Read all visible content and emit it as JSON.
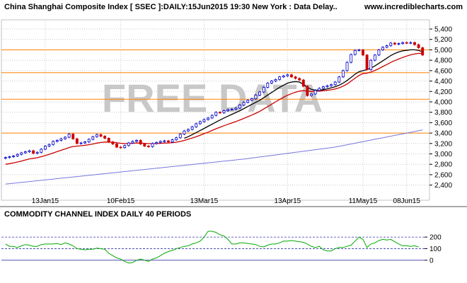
{
  "header": {
    "title": "China Shanghai Composite Index [ SSEC ]:DAILY:15Jun2015 19:30 New York : Data Delay..",
    "site": "www.incrediblecharts.com"
  },
  "watermark": "FREE DATA",
  "colors": {
    "bull": "#0000cc",
    "bear": "#cc0000",
    "ema_short": "#cc0000",
    "ema_mid": "#000000",
    "ma_long": "#7777dd",
    "resistance": "#ff8000",
    "cci": "#00aa00",
    "cci_zero": "#3333aa",
    "grid": "#c8c8c8"
  },
  "chart_data": [
    {
      "type": "candlestick",
      "ylim": [
        2150,
        5550
      ],
      "y_ticks": [
        "2,400",
        "2,600",
        "2,800",
        "3,000",
        "3,200",
        "3,400",
        "3,600",
        "3,800",
        "4,000",
        "4,200",
        "4,400",
        "4,600",
        "4,800",
        "5,000",
        "5,200",
        "5,400"
      ],
      "x_tick_labels": [
        "13Jan15",
        "10Feb15",
        "13Mar15",
        "13Apr15",
        "11May15",
        "08Jun15"
      ],
      "horizontal_lines": [
        3400,
        4050,
        4560,
        5000
      ],
      "closes": [
        2930,
        2945,
        2960,
        2990,
        3020,
        3040,
        3060,
        3010,
        3030,
        3090,
        3150,
        3180,
        3240,
        3260,
        3290,
        3320,
        3380,
        3290,
        3200,
        3210,
        3230,
        3280,
        3330,
        3370,
        3340,
        3300,
        3230,
        3190,
        3130,
        3120,
        3160,
        3210,
        3240,
        3260,
        3190,
        3150,
        3140,
        3200,
        3220,
        3240,
        3250,
        3230,
        3270,
        3310,
        3380,
        3440,
        3470,
        3520,
        3580,
        3620,
        3660,
        3690,
        3740,
        3800,
        3790,
        3830,
        3850,
        3860,
        3880,
        3940,
        3990,
        4030,
        4060,
        4130,
        4190,
        4280,
        4360,
        4400,
        4430,
        4480,
        4500,
        4520,
        4480,
        4450,
        4420,
        4300,
        4120,
        4150,
        4220,
        4260,
        4290,
        4310,
        4330,
        4380,
        4480,
        4600,
        4760,
        4910,
        4990,
        5000,
        4900,
        4620,
        4800,
        4900,
        5000,
        5050,
        5080,
        5130,
        5110,
        5120,
        5140,
        5130,
        5140,
        5100,
        5040,
        4900
      ],
      "series": [
        {
          "name": "",
          "kind": "ema_short",
          "values": [
            2800,
            2812,
            2826,
            2843,
            2862,
            2883,
            2904,
            2915,
            2927,
            2946,
            2968,
            2992,
            3018,
            3043,
            3069,
            3094,
            3123,
            3141,
            3149,
            3157,
            3165,
            3177,
            3191,
            3207,
            3219,
            3227,
            3228,
            3224,
            3214,
            3204,
            3199,
            3200,
            3204,
            3210,
            3208,
            3203,
            3197,
            3197,
            3199,
            3203,
            3208,
            3210,
            3216,
            3225,
            3240,
            3259,
            3281,
            3305,
            3331,
            3359,
            3389,
            3418,
            3450,
            3483,
            3511,
            3541,
            3569,
            3596,
            3622,
            3652,
            3682,
            3714,
            3745,
            3781,
            3819,
            3862,
            3908,
            3955,
            4000,
            4046,
            4088,
            4128,
            4159,
            4185,
            4206,
            4214,
            4205,
            4200,
            4202,
            4207,
            4214,
            4223,
            4232,
            4247,
            4270,
            4301,
            4343,
            4399,
            4455,
            4508,
            4544,
            4551,
            4574,
            4603,
            4639,
            4679,
            4718,
            4759,
            4793,
            4824,
            4854,
            4880,
            4904,
            4921,
            4932,
            4930
          ]
        },
        {
          "name": "",
          "kind": "ema_mid",
          "values": [
            null,
            null,
            null,
            null,
            null,
            null,
            null,
            null,
            null,
            null,
            null,
            null,
            null,
            null,
            null,
            null,
            null,
            null,
            null,
            null,
            null,
            null,
            null,
            null,
            null,
            null,
            null,
            null,
            null,
            null,
            null,
            null,
            null,
            null,
            null,
            null,
            null,
            null,
            null,
            null,
            null,
            null,
            null,
            null,
            null,
            3300,
            3330,
            3370,
            3410,
            3450,
            3490,
            3530,
            3570,
            3610,
            3650,
            3690,
            3725,
            3760,
            3795,
            3830,
            3870,
            3910,
            3950,
            3990,
            4030,
            4080,
            4130,
            4180,
            4230,
            4280,
            4320,
            4360,
            4380,
            4390,
            4380,
            4340,
            4280,
            4240,
            4225,
            4225,
            4235,
            4250,
            4270,
            4290,
            4320,
            4360,
            4410,
            4470,
            4530,
            4580,
            4600,
            4620,
            4650,
            4690,
            4740,
            4790,
            4840,
            4890,
            4930,
            4960,
            4980,
            4990,
            5000,
            5000,
            4990,
            4960
          ]
        },
        {
          "name": "",
          "kind": "ma_long",
          "values": [
            2420,
            2428,
            2436,
            2444,
            2452,
            2460,
            2468,
            2476,
            2484,
            2492,
            2500,
            2508,
            2516,
            2524,
            2532,
            2540,
            2548,
            2556,
            2564,
            2572,
            2580,
            2588,
            2596,
            2604,
            2612,
            2620,
            2628,
            2636,
            2644,
            2652,
            2660,
            2668,
            2676,
            2684,
            2692,
            2700,
            2708,
            2716,
            2724,
            2732,
            2740,
            2748,
            2756,
            2764,
            2772,
            2780,
            2788,
            2796,
            2804,
            2812,
            2820,
            2828,
            2836,
            2844,
            2852,
            2860,
            2868,
            2876,
            2884,
            2892,
            2900,
            2910,
            2920,
            2930,
            2940,
            2950,
            2960,
            2970,
            2980,
            2990,
            3000,
            3010,
            3020,
            3030,
            3040,
            3050,
            3060,
            3070,
            3080,
            3090,
            3100,
            3110,
            3120,
            3130,
            3145,
            3160,
            3175,
            3190,
            3205,
            3220,
            3235,
            3250,
            3265,
            3280,
            3295,
            3310,
            3325,
            3340,
            3355,
            3370,
            3385,
            3400,
            3415,
            3430,
            3445,
            3460
          ]
        }
      ]
    },
    {
      "type": "line",
      "title": "COMMODITY CHANNEL INDEX DAILY 40 PERIODS",
      "ylim": [
        -50,
        280
      ],
      "y_ticks": [
        "200",
        "100",
        "0"
      ],
      "reference_lines": [
        200,
        100,
        0
      ],
      "values": [
        140,
        120,
        120,
        110,
        125,
        135,
        130,
        120,
        120,
        135,
        140,
        140,
        140,
        145,
        135,
        150,
        140,
        125,
        100,
        95,
        90,
        95,
        95,
        105,
        100,
        95,
        60,
        40,
        20,
        10,
        -10,
        -25,
        -20,
        0,
        10,
        0,
        -10,
        10,
        20,
        40,
        60,
        75,
        85,
        100,
        110,
        120,
        125,
        140,
        150,
        165,
        200,
        250,
        250,
        240,
        220,
        210,
        180,
        140,
        140,
        150,
        150,
        145,
        140,
        135,
        120,
        115,
        130,
        140,
        140,
        150,
        165,
        165,
        170,
        165,
        160,
        155,
        140,
        120,
        110,
        120,
        90,
        80,
        80,
        100,
        110,
        110,
        120,
        130,
        165,
        200,
        180,
        110,
        140,
        150,
        170,
        180,
        175,
        180,
        160,
        140,
        125,
        125,
        120,
        125,
        115
      ]
    }
  ]
}
